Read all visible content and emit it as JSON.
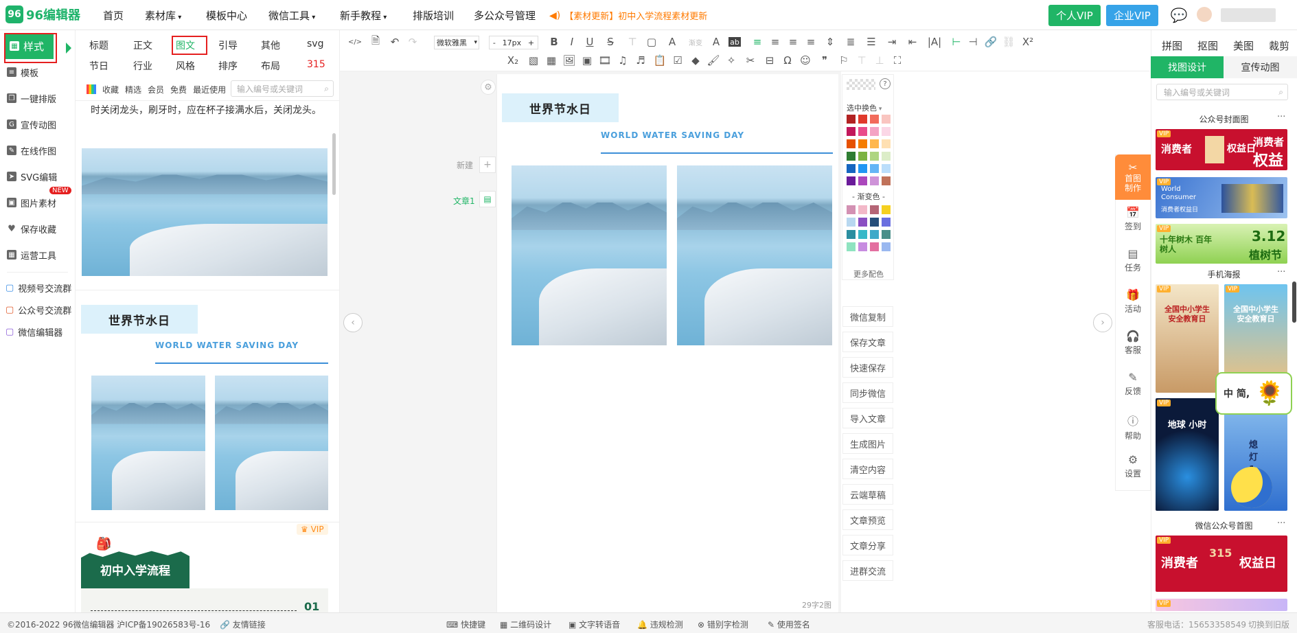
{
  "brand": {
    "name": "96编辑器",
    "logo_glyph": "96",
    "accent": "#20b566"
  },
  "topnav": {
    "items": [
      "首页",
      "素材库",
      "模板中心",
      "微信工具",
      "新手教程",
      "排版培训",
      "多公众号管理"
    ],
    "notice": "【素材更新】初中入学流程素材更新",
    "personal_vip": "个人VIP",
    "company_vip": "企业VIP"
  },
  "sidebar": {
    "items": [
      "样式",
      "模板",
      "一键排版",
      "宣传动图",
      "在线作图",
      "SVG编辑",
      "图片素材",
      "保存收藏",
      "运营工具"
    ],
    "new_tag": "NEW",
    "groups": [
      "视频号交流群",
      "公众号交流群",
      "微信编辑器"
    ]
  },
  "style_panel": {
    "row1": [
      "标题",
      "正文",
      "图文",
      "引导",
      "其他",
      "svg"
    ],
    "row2": [
      "节日",
      "行业",
      "风格",
      "排序",
      "布局",
      "315"
    ],
    "filters": [
      "收藏",
      "精选",
      "会员",
      "免费",
      "最近使用"
    ],
    "search_placeholder": "输入编号或关键词",
    "snippet_text": "时关闭龙头，刷牙时，应在杯子接满水后，关闭龙头。",
    "card_title": "世界节水日",
    "card_sub": "WORLD WATER SAVING DAY",
    "vip_label": "VIP",
    "banner_title": "初中入学流程",
    "banner_num": "01"
  },
  "editor": {
    "font": "微软雅黑",
    "font_size": "17px",
    "new_label": "新建",
    "doc_label": "文章1",
    "title": "世界节水日",
    "subtitle": "WORLD WATER SAVING DAY",
    "word_count": "29字2图"
  },
  "colors": {
    "label": "选中换色",
    "gradient_label": "- 渐变色 -",
    "more": "更多配色",
    "solid": [
      "#b22222",
      "#e0392b",
      "#f26b5b",
      "#f9c5c0",
      "#c2185b",
      "#e94c8b",
      "#f4a3c4",
      "#fbd7e6",
      "#e65100",
      "#f57c00",
      "#ffb74d",
      "#ffe0b2",
      "#2e7d32",
      "#7cb342",
      "#aed581",
      "#dcedc8",
      "#1565c0",
      "#2196f3",
      "#64b5f6",
      "#bbdefb",
      "#6a1b9a",
      "#ab47bc",
      "#ce93d8",
      "#c0725a"
    ],
    "gradient": [
      "#d391b3",
      "#f2b8c8",
      "#b56576",
      "#f5d020",
      "#b8d8f0",
      "#8a4fc2",
      "#254e7a",
      "#6a6fe0",
      "#2a8ea0",
      "#38b8c8",
      "#3fa9c9",
      "#4a8f8a",
      "#8fe3c0",
      "#c78ce0",
      "#e36fa0",
      "#9ab8f0"
    ]
  },
  "actions": [
    "微信复制",
    "保存文章",
    "快速保存",
    "同步微信",
    "导入文章",
    "生成图片",
    "清空内容",
    "云端草稿",
    "文章预览",
    "文章分享",
    "进群交流"
  ],
  "vtools": [
    "首图制作",
    "签到",
    "任务",
    "活动",
    "客服",
    "反馈",
    "帮助",
    "设置"
  ],
  "right_panel": {
    "tabs": [
      "拼图",
      "抠图",
      "美图",
      "裁剪"
    ],
    "subtabs": [
      "找图设计",
      "宣传动图"
    ],
    "search_placeholder": "输入编号或关键词",
    "sec1": "公众号封面图",
    "sec2": "手机海报",
    "sec3": "微信公众号首图",
    "more": "···",
    "vip": "VIP",
    "card1": {
      "left": "消费者",
      "mid": "权益日",
      "right": "消费者",
      "right2": "权益"
    },
    "card2": {
      "l1": "World",
      "l2": "Consumer",
      "l3": "消费者权益日"
    },
    "card3": {
      "left": "十年树木 百年树人",
      "right": "3.12",
      "right2": "植树节"
    },
    "poster1": "全国中小学生安全教育日",
    "poster2": "全国中小学生安全教育日",
    "poster3": "地球 小时",
    "poster4": "熄灯 1 小时",
    "card4": {
      "left": "消费者",
      "right": "权益日",
      "mid": "315"
    },
    "floating": "中 简,"
  },
  "footer": {
    "copyright": "©2016-2022 96微信编辑器 沪ICP备19026583号-16",
    "links": "友情链接",
    "tools": [
      "快捷键",
      "二维码设计",
      "文字转语音",
      "违规检测",
      "错别字检测",
      "使用签名"
    ],
    "hotline": "客服电话：15653358549",
    "old": "切换到旧版"
  }
}
